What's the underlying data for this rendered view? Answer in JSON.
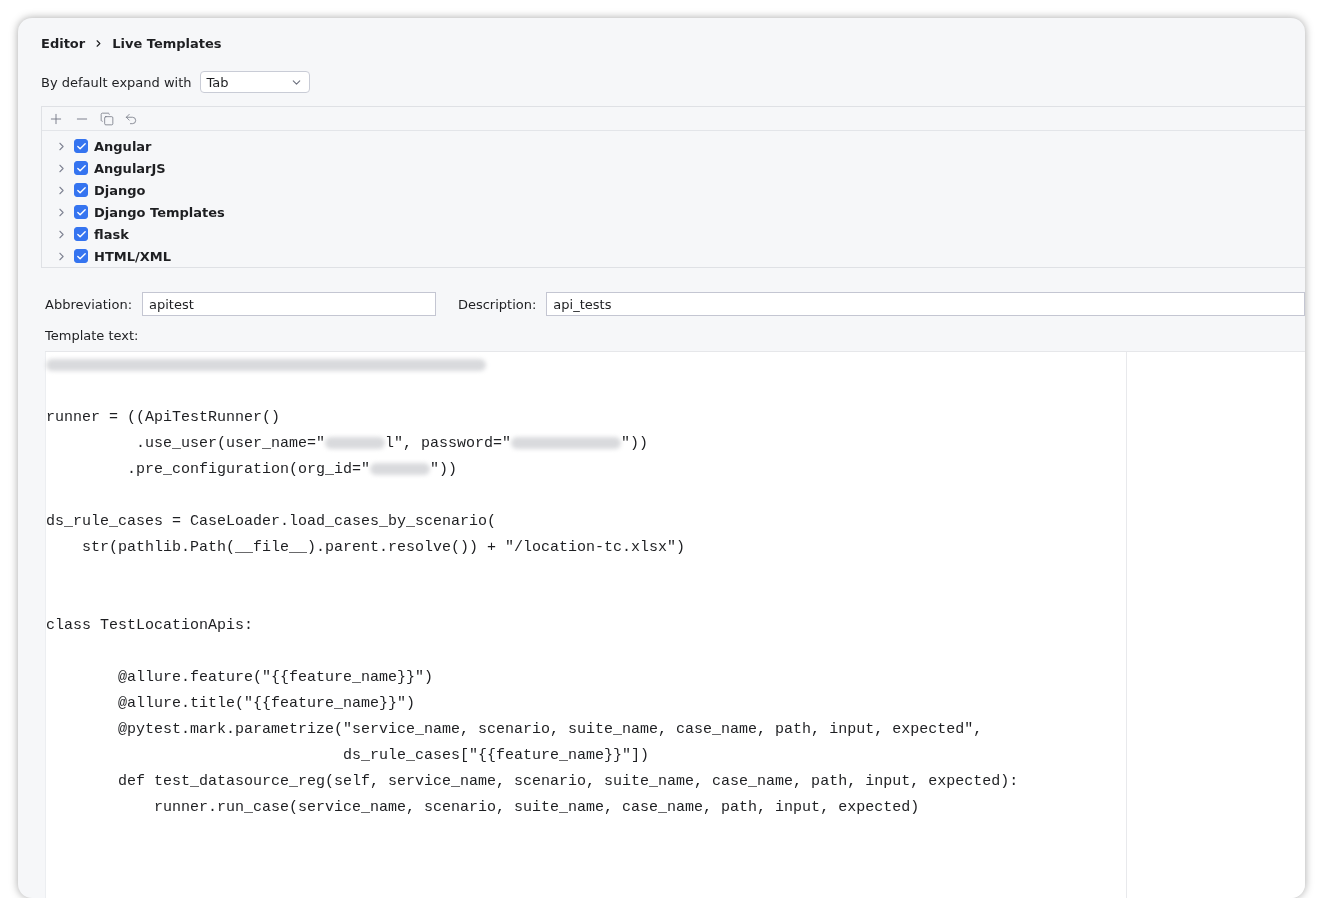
{
  "breadcrumb": [
    {
      "label": "Editor"
    },
    {
      "label": "Live Templates"
    }
  ],
  "expand": {
    "label": "By default expand with",
    "value": "Tab"
  },
  "template_groups": [
    {
      "label": "Angular",
      "checked": true,
      "expanded": false
    },
    {
      "label": "AngularJS",
      "checked": true,
      "expanded": false
    },
    {
      "label": "Django",
      "checked": true,
      "expanded": false
    },
    {
      "label": "Django Templates",
      "checked": true,
      "expanded": false
    },
    {
      "label": "flask",
      "checked": true,
      "expanded": false
    },
    {
      "label": "HTML/XML",
      "checked": true,
      "expanded": false
    }
  ],
  "abbreviation": {
    "label": "Abbreviation:",
    "value": "apitest"
  },
  "description": {
    "label": "Description:",
    "value": "api_tests"
  },
  "template_text": {
    "label": "Template text:",
    "lines": [
      {
        "kind": "code",
        "segments": [
          {
            "kind": "blur"
          }
        ]
      },
      {
        "kind": "blank"
      },
      {
        "kind": "code",
        "segments": [
          {
            "kind": "text",
            "text": "runner = ((ApiTestRunner()"
          }
        ]
      },
      {
        "kind": "code",
        "segments": [
          {
            "kind": "text",
            "text": "          .use_user(user_name=\""
          },
          {
            "kind": "blur"
          },
          {
            "kind": "text",
            "text": "l\", password=\""
          },
          {
            "kind": "blur"
          },
          {
            "kind": "text",
            "text": "\"))"
          }
        ]
      },
      {
        "kind": "code",
        "segments": [
          {
            "kind": "text",
            "text": "         .pre_configuration(org_id=\""
          },
          {
            "kind": "blur"
          },
          {
            "kind": "text",
            "text": "\"))"
          }
        ]
      },
      {
        "kind": "blank"
      },
      {
        "kind": "code",
        "segments": [
          {
            "kind": "text",
            "text": "ds_rule_cases = CaseLoader.load_cases_by_scenario("
          }
        ]
      },
      {
        "kind": "code",
        "segments": [
          {
            "kind": "text",
            "text": "    str(pathlib.Path(__file__).parent.resolve()) + \"/location-tc.xlsx\")"
          }
        ]
      },
      {
        "kind": "blank"
      },
      {
        "kind": "blank"
      },
      {
        "kind": "code",
        "segments": [
          {
            "kind": "text",
            "text": "class TestLocationApis:"
          }
        ]
      },
      {
        "kind": "blank"
      },
      {
        "kind": "code",
        "segments": [
          {
            "kind": "text",
            "text": "        @allure.feature(\"{{feature_name}}\")"
          }
        ]
      },
      {
        "kind": "code",
        "segments": [
          {
            "kind": "text",
            "text": "        @allure.title(\"{{feature_name}}\")"
          }
        ]
      },
      {
        "kind": "code",
        "segments": [
          {
            "kind": "text",
            "text": "        @pytest.mark.parametrize(\"service_name, scenario, suite_name, case_name, path, input, expected\","
          }
        ]
      },
      {
        "kind": "code",
        "segments": [
          {
            "kind": "text",
            "text": "                                 ds_rule_cases[\"{{feature_name}}\"])"
          }
        ]
      },
      {
        "kind": "code",
        "segments": [
          {
            "kind": "text",
            "text": "        def test_datasource_reg(self, service_name, scenario, suite_name, case_name, path, input, expected):"
          }
        ]
      },
      {
        "kind": "code",
        "segments": [
          {
            "kind": "text",
            "text": "            runner.run_case(service_name, scenario, suite_name, case_name, path, input, expected)"
          }
        ]
      }
    ]
  }
}
